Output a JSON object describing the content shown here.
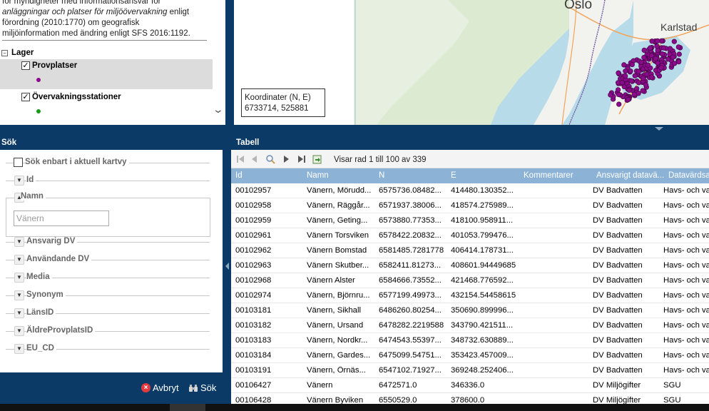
{
  "info": {
    "line1": "för myndigheter med informationsansvar för",
    "line2": "anläggningar och platser för miljöövervakning",
    "line2b": " enligt",
    "line3": "förordning (2010:1770) om geografisk",
    "line4": "miljöinformation med ändring enligt SFS 2016:1192."
  },
  "layers": {
    "group_label": "Lager",
    "toggle_symbol": "−",
    "items": [
      {
        "name": "Provplatser",
        "checked": "✓",
        "color": "#8b0a8b"
      },
      {
        "name": "Övervakningsstationer",
        "checked": "✓",
        "color": "#1a9a1a"
      }
    ]
  },
  "map": {
    "coord_title": "Koordinater (N, E)",
    "coord_value": "6733714, 525881",
    "label_oslo": "Oslo",
    "label_karlstad": "Karlstad",
    "colors": {
      "water": "#b7dbe8",
      "land": "#f2f2ef",
      "forest": "#dcead2",
      "points": "#8b0a8b",
      "roads": "#f2a45b",
      "borders": "#6b4f9e"
    }
  },
  "panels": {
    "search_title": "Sök",
    "table_title": "Tabell"
  },
  "search": {
    "only_current_label": "Sök enbart i aktuell kartvy",
    "fields": [
      "Id",
      "Namn",
      "Ansvarig DV",
      "Användande DV",
      "Media",
      "Synonym",
      "LänsID",
      "ÄldreProvplatsID",
      "EU_CD"
    ],
    "namn_placeholder": "Vänern",
    "cancel_label": "Avbryt",
    "search_label": "Sök"
  },
  "table": {
    "paging_text": "Visar rad 1 till 100 av 339",
    "columns": [
      "Id",
      "Namn",
      "N",
      "E",
      "Kommentarer",
      "Ansvarigt datavä...",
      "Datavärdsa"
    ],
    "rows": [
      [
        "00102957",
        "Vänern, Mörudd...",
        "6575736.08482...",
        "414480.130352...",
        "",
        "DV Badvatten",
        "Havs- och va"
      ],
      [
        "00102958",
        "Vänern, Räggår...",
        "6571937.38006...",
        "418574.275989...",
        "",
        "DV Badvatten",
        "Havs- och va"
      ],
      [
        "00102959",
        "Vänern, Geting...",
        "6573880.77353...",
        "418100.958911...",
        "",
        "DV Badvatten",
        "Havs- och va"
      ],
      [
        "00102961",
        "Vänern Torsviken",
        "6578422.20832...",
        "401053.799476...",
        "",
        "DV Badvatten",
        "Havs- och va"
      ],
      [
        "00102962",
        "Vänern Bomstad",
        "6581485.7281778",
        "406414.178731...",
        "",
        "DV Badvatten",
        "Havs- och va"
      ],
      [
        "00102963",
        "Vänern Skutber...",
        "6582411.81273...",
        "408601.94449685",
        "",
        "DV Badvatten",
        "Havs- och va"
      ],
      [
        "00102968",
        "Vänern Alster",
        "6584666.73552...",
        "421468.776592...",
        "",
        "DV Badvatten",
        "Havs- och va"
      ],
      [
        "00102974",
        "Vänern, Björnru...",
        "6577199.49973...",
        "432154.54458615",
        "",
        "DV Badvatten",
        "Havs- och va"
      ],
      [
        "00103181",
        "Vänern, Sikhall",
        "6486260.80254...",
        "350690.899996...",
        "",
        "DV Badvatten",
        "Havs- och va"
      ],
      [
        "00103182",
        "Vänern, Ursand",
        "6478282.2219588",
        "343790.421511...",
        "",
        "DV Badvatten",
        "Havs- och va"
      ],
      [
        "00103183",
        "Vänern, Nordkr...",
        "6474543.55397...",
        "348732.630889...",
        "",
        "DV Badvatten",
        "Havs- och va"
      ],
      [
        "00103184",
        "Vänern, Gardes...",
        "6475099.54751...",
        "353423.457009...",
        "",
        "DV Badvatten",
        "Havs- och va"
      ],
      [
        "00103191",
        "Vänern, Örnäs...",
        "6547102.71927...",
        "369248.252406...",
        "",
        "DV Badvatten",
        "Havs- och va"
      ],
      [
        "00106427",
        "Vänern",
        "6472571.0",
        "346336.0",
        "",
        "DV Miljögifter",
        "SGU"
      ],
      [
        "00106428",
        "Vänern Byviken",
        "6550529.0",
        "378600.0",
        "",
        "DV Miljögifter",
        "SGU"
      ]
    ]
  }
}
